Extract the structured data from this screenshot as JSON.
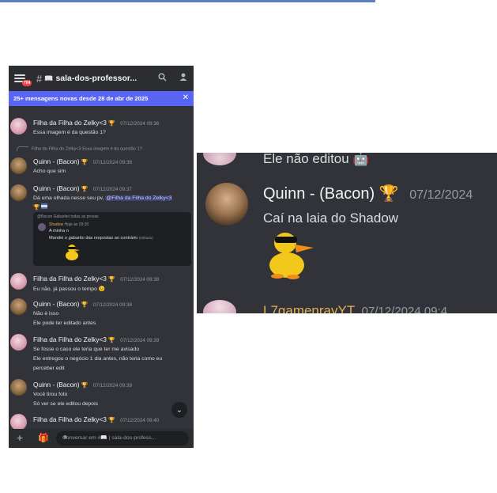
{
  "channel": {
    "name": "sala-dos-professor...",
    "badge": "704",
    "hash": "#",
    "book_icon": "📖"
  },
  "banner": {
    "text": "25+ mensagens novas desde 28 de abr de 2025",
    "close": "✕"
  },
  "trophy": "🏆",
  "messages": [
    {
      "user": "Filha da Filha do Zelky<3",
      "time": "07/12/2024 09:36",
      "lines": [
        "Essa imagem é da questão 1?"
      ]
    },
    {
      "reply": "Filha da Filha do Zelky<3  Essa imagem é da questão 1?",
      "user": "Quinn - (Bacon)",
      "time": "07/12/2024 09:36",
      "lines": [
        "Acho que sim"
      ]
    },
    {
      "user": "Quinn - (Bacon)",
      "time": "07/12/2024 09:37",
      "line1_pre": "Dá uma olhada nesse seu pv,",
      "mention": "@Filha da Filha do Zelky<3"
    },
    {
      "user": "Filha da Filha do Zelky<3",
      "time": "07/12/2024 09:38",
      "lines": [
        "Eu não, já passou o tempo 😉"
      ]
    },
    {
      "user": "Quinn - (Bacon)",
      "time": "07/12/2024 09:38",
      "lines": [
        "Não é isso",
        "Ele pode ter editado antes"
      ]
    },
    {
      "user": "Filha da Filha do Zelky<3",
      "time": "07/12/2024 09:39",
      "lines": [
        "Se fosse o caso ele teria que ter me avisado",
        "Ele entregou o negócio 1 dia antes, não teria como eu",
        "perceber edit"
      ]
    },
    {
      "user": "Quinn - (Bacon)",
      "time": "07/12/2024 09:39",
      "lines": [
        "Você tirou foto",
        "Só ver se ele editou depois"
      ]
    },
    {
      "user": "Filha da Filha do Zelky<3",
      "time": "07/12/2024 09:40",
      "lines": []
    }
  ],
  "embed": {
    "header": "@Bacon Gabaritei todas as provas",
    "author": "Shadow",
    "author_time": "Hoje às 09:30",
    "line1": "A minha n",
    "line2": "Mandei o gabarito das respostas ao contrário",
    "line2_tag": "(editado)"
  },
  "composer": {
    "placeholder": "Conversar em #📖 | sala-dos-profess...",
    "plus": "+",
    "gift": "🎁",
    "emoji": "☻"
  },
  "zoom": {
    "top_text": "Ele não editou 🤖",
    "user": "Quinn - (Bacon) 🏆",
    "time": "07/12/2024",
    "text": "Caí na laia do Shadow",
    "bottom_user": "L7gamenrayYT",
    "bottom_time": "07/12/2024 09:4"
  }
}
